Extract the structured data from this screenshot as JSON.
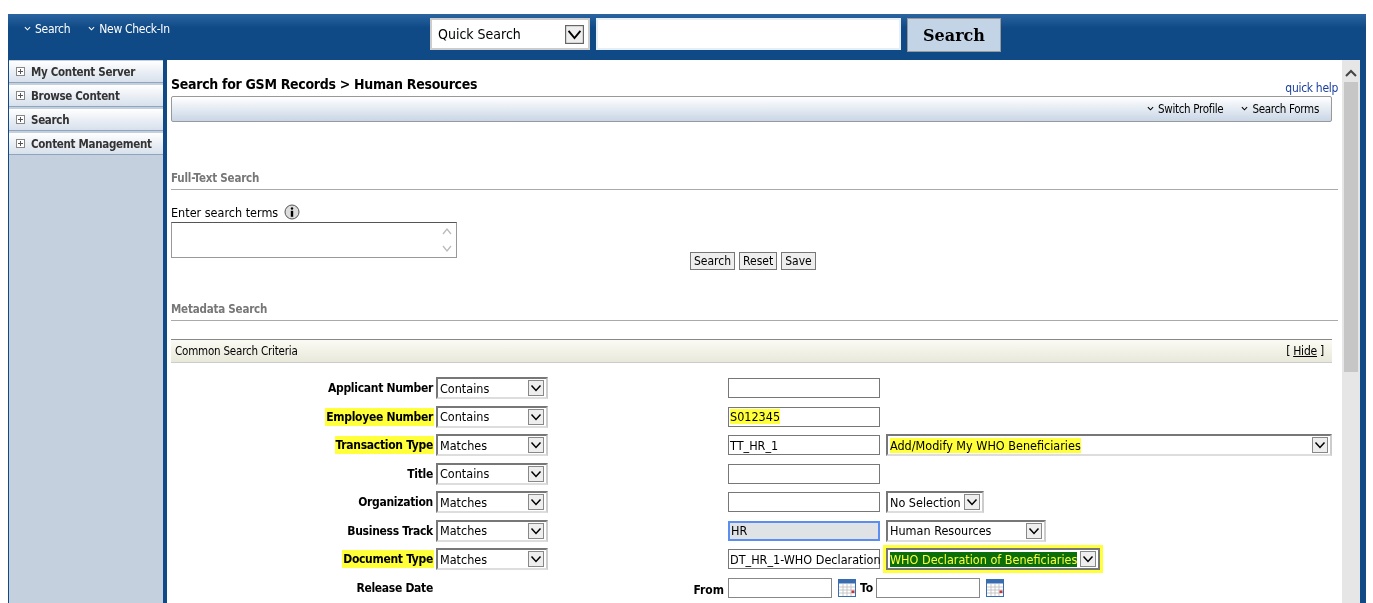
{
  "top_nav": [
    {
      "label": "Search"
    },
    {
      "label": "New Check-In"
    }
  ],
  "quick_search": {
    "scope": "Quick Search",
    "button": "Search"
  },
  "sidebar": {
    "items": [
      {
        "label": "My Content Server",
        "expanded": false
      },
      {
        "label": "Browse Content",
        "expanded": false
      },
      {
        "label": "Search",
        "expanded": false
      },
      {
        "label": "Content Management",
        "expanded": false
      }
    ]
  },
  "page": {
    "title": "Search for GSM Records > Human Resources",
    "quick_help": "quick help",
    "toolbar": [
      {
        "label": "Switch Profile"
      },
      {
        "label": "Search Forms"
      }
    ]
  },
  "full_text": {
    "heading": "Full-Text Search",
    "label": "Enter search terms",
    "buttons": [
      "Search",
      "Reset",
      "Save"
    ]
  },
  "metadata": {
    "heading": "Metadata Search",
    "panel_title": "Common Search Criteria",
    "hide_link": {
      "open": "[",
      "label": "Hide",
      "close": "]"
    },
    "rows": [
      {
        "kind": "field",
        "label": "Applicant Number",
        "label_highlighted": false,
        "operator": "Contains",
        "value": "",
        "focused": false
      },
      {
        "kind": "field",
        "label": "Employee Number",
        "label_highlighted": true,
        "operator": "Contains",
        "value": "S012345",
        "value_highlighted": true,
        "focused": false
      },
      {
        "kind": "field",
        "label": "Transaction Type",
        "label_highlighted": true,
        "operator": "Matches",
        "value": "TT_HR_1",
        "value_highlighted": false,
        "focused": false,
        "option": {
          "text": "Add/Modify My WHO Beneficiaries",
          "kind": "wide",
          "highlighted": true,
          "selected": false
        }
      },
      {
        "kind": "field",
        "label": "Title",
        "label_highlighted": false,
        "operator": "Contains",
        "value": "",
        "focused": false
      },
      {
        "kind": "field",
        "label": "Organization",
        "label_highlighted": false,
        "operator": "Matches",
        "value": "",
        "focused": false,
        "option": {
          "text": "No Selection",
          "kind": "fit",
          "highlighted": false,
          "selected": false
        }
      },
      {
        "kind": "field",
        "label": "Business Track",
        "label_highlighted": false,
        "operator": "Matches",
        "value": "HR",
        "value_highlighted": false,
        "focused": true,
        "option": {
          "text": "Human Resources",
          "kind": "medium",
          "highlighted": false,
          "selected": false
        }
      },
      {
        "kind": "field",
        "label": "Document Type",
        "label_highlighted": true,
        "operator": "Matches",
        "value": "DT_HR_1-WHO Declaration",
        "value_highlighted": false,
        "focused": false,
        "option": {
          "text": "WHO Declaration of Beneficiaries",
          "kind": "fit",
          "highlighted": true,
          "selected": true
        }
      },
      {
        "kind": "date_range",
        "label": "Release Date",
        "label_highlighted": false,
        "from_label": "From",
        "to_label": "To"
      }
    ]
  }
}
